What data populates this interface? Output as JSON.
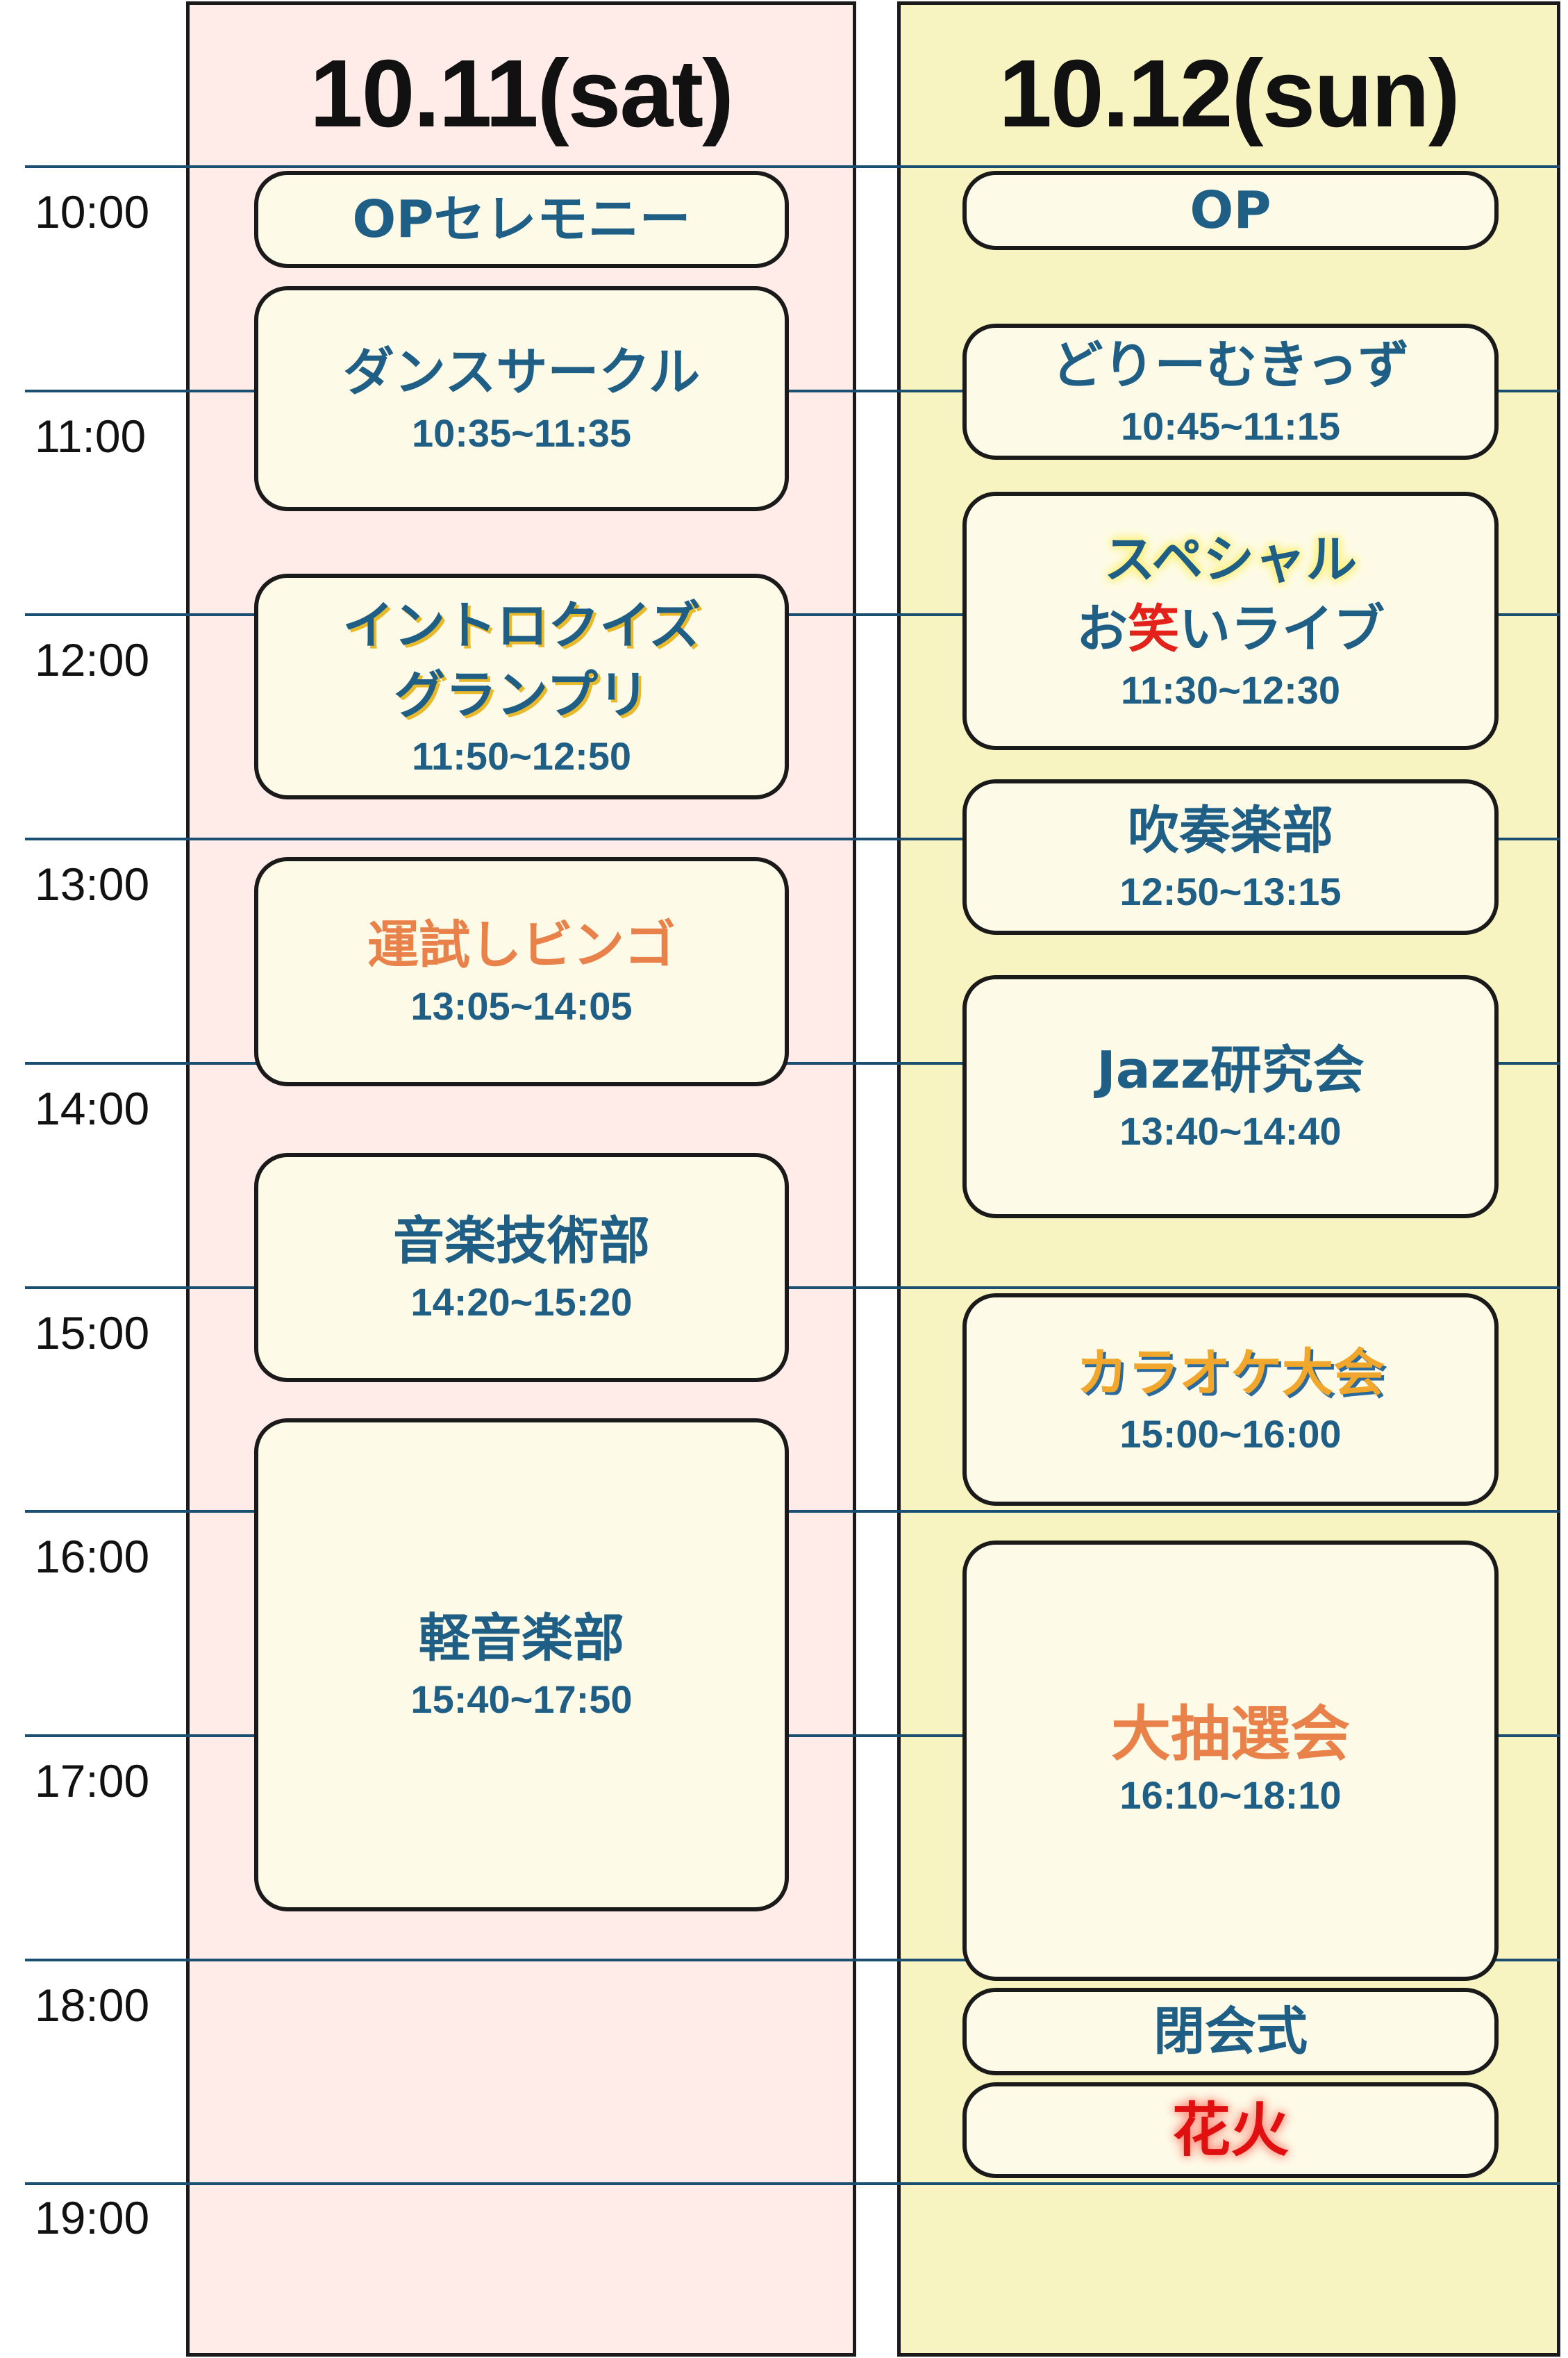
{
  "days": [
    {
      "title": "10.11(sat)",
      "color": "#ffebe7"
    },
    {
      "title": "10.12(sun)",
      "color": "#f8f4c2"
    }
  ],
  "times": [
    "10:00",
    "11:00",
    "12:00",
    "13:00",
    "14:00",
    "15:00",
    "16:00",
    "17:00",
    "18:00",
    "19:00"
  ],
  "sat": {
    "op": {
      "name": "OPセレモニー"
    },
    "dance": {
      "name": "ダンスサークル",
      "time": "10:35~11:35"
    },
    "intro": {
      "name1": "イントロクイズ",
      "name2": "グランプリ",
      "time": "11:50~12:50"
    },
    "bingo": {
      "name": "運試しビンゴ",
      "time": "13:05~14:05"
    },
    "ongaku": {
      "name": "音楽技術部",
      "time": "14:20~15:20"
    },
    "keion": {
      "name": "軽音楽部",
      "time": "15:40~17:50"
    }
  },
  "sun": {
    "op": {
      "name": "OP"
    },
    "dream": {
      "name": "どりーむきっず",
      "time": "10:45~11:15"
    },
    "special": {
      "line1": "スペシャル",
      "pre": "お",
      "warai": "笑",
      "post": "いライブ",
      "time": "11:30~12:30"
    },
    "suisou": {
      "name": "吹奏楽部",
      "time": "12:50~13:15"
    },
    "jazz": {
      "name": "Jazz研究会",
      "time": "13:40~14:40"
    },
    "karaoke": {
      "name": "カラオケ大会",
      "time": "15:00~16:00"
    },
    "chusen": {
      "name": "大抽選会",
      "time": "16:10~18:10"
    },
    "heikai": {
      "name": "閉会式"
    },
    "hanabi": {
      "name": "花火"
    }
  },
  "colors": {
    "line": "#1b4f72",
    "text_blue": "#1f5f86",
    "orange": "#e9824a",
    "red": "#e3221c"
  }
}
